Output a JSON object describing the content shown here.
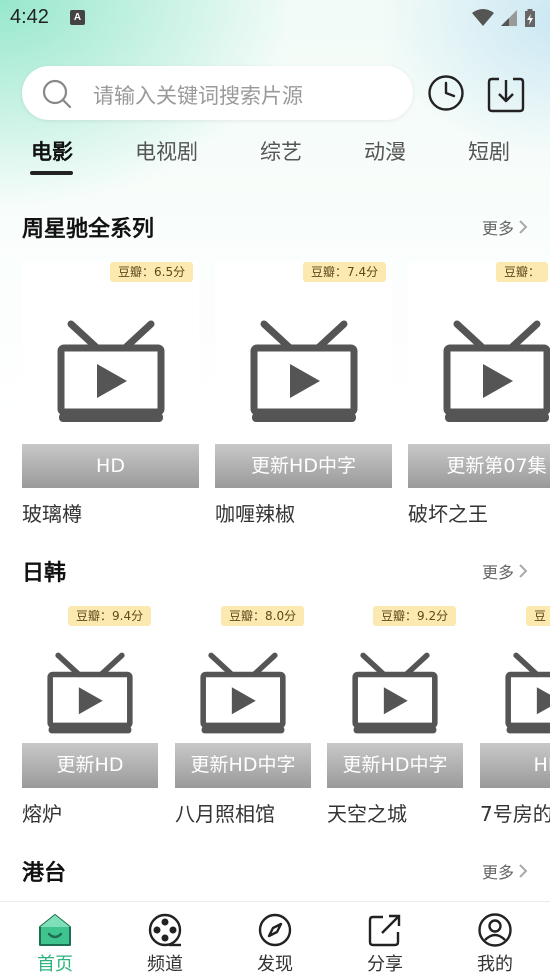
{
  "status": {
    "time": "4:42",
    "notif_letter": "A"
  },
  "search": {
    "placeholder": "请输入关键词搜索片源"
  },
  "tabs": [
    {
      "label": "电影",
      "active": true
    },
    {
      "label": "电视剧",
      "active": false
    },
    {
      "label": "综艺",
      "active": false
    },
    {
      "label": "动漫",
      "active": false
    },
    {
      "label": "短剧",
      "active": false
    }
  ],
  "sections": [
    {
      "title": "周星驰全系列",
      "more": "更多",
      "cards": [
        {
          "badge": "豆瓣：6.5分",
          "banner": "HD",
          "title": "玻璃樽"
        },
        {
          "badge": "豆瓣：7.4分",
          "banner": "更新HD中字",
          "title": "咖喱辣椒"
        },
        {
          "badge": "豆瓣：",
          "banner": "更新第07集",
          "title": "破坏之王"
        }
      ]
    },
    {
      "title": "日韩",
      "more": "更多",
      "cards": [
        {
          "badge": "豆瓣：9.4分",
          "banner": "更新HD",
          "title": "熔炉"
        },
        {
          "badge": "豆瓣：8.0分",
          "banner": "更新HD中字",
          "title": "八月照相馆"
        },
        {
          "badge": "豆瓣：9.2分",
          "banner": "更新HD中字",
          "title": "天空之城"
        },
        {
          "badge": "豆",
          "banner": "HD",
          "title": "7号房的"
        }
      ]
    },
    {
      "title": "港台",
      "more": "更多"
    }
  ],
  "bottom_nav": [
    {
      "label": "首页",
      "icon": "home-icon",
      "active": true
    },
    {
      "label": "频道",
      "icon": "film-reel-icon",
      "active": false
    },
    {
      "label": "发现",
      "icon": "compass-icon",
      "active": false
    },
    {
      "label": "分享",
      "icon": "share-icon",
      "active": false
    },
    {
      "label": "我的",
      "icon": "user-icon",
      "active": false
    }
  ],
  "colors": {
    "accent": "#2db37d",
    "badge_bg": "#fce9b0",
    "banner": "#b0b0b0"
  }
}
